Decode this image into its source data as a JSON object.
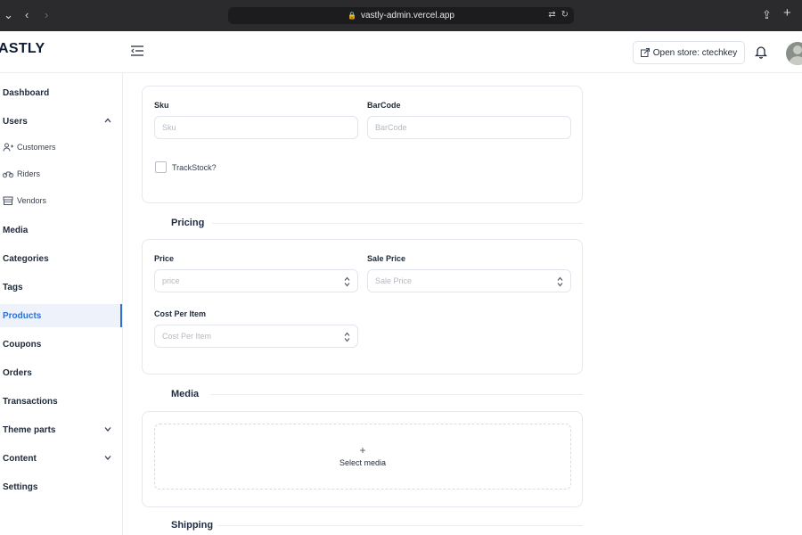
{
  "browser": {
    "url": "vastly-admin.vercel.app"
  },
  "header": {
    "logo": "ASTLY",
    "open_store_label": "Open store: ctechkey"
  },
  "sidebar": {
    "items": [
      {
        "label": "Dashboard"
      },
      {
        "label": "Users"
      },
      {
        "label": "Customers"
      },
      {
        "label": "Riders"
      },
      {
        "label": "Vendors"
      },
      {
        "label": "Media"
      },
      {
        "label": "Categories"
      },
      {
        "label": "Tags"
      },
      {
        "label": "Products"
      },
      {
        "label": "Coupons"
      },
      {
        "label": "Orders"
      },
      {
        "label": "Transactions"
      },
      {
        "label": "Theme parts"
      },
      {
        "label": "Content"
      },
      {
        "label": "Settings"
      }
    ],
    "active": "Products"
  },
  "inventory": {
    "sku_label": "Sku",
    "sku_placeholder": "Sku",
    "barcode_label": "BarCode",
    "barcode_placeholder": "BarCode",
    "trackstock_label": "TrackStock?"
  },
  "pricing": {
    "title": "Pricing",
    "price_label": "Price",
    "price_placeholder": "price",
    "sale_price_label": "Sale Price",
    "sale_price_placeholder": "Sale Price",
    "cost_label": "Cost Per Item",
    "cost_placeholder": "Cost Per Item"
  },
  "media": {
    "title": "Media",
    "plus": "+",
    "select_label": "Select media"
  },
  "shipping": {
    "title": "Shipping"
  },
  "colors": {
    "accent": "#2f6fce",
    "active_bg": "#eef3fb"
  }
}
